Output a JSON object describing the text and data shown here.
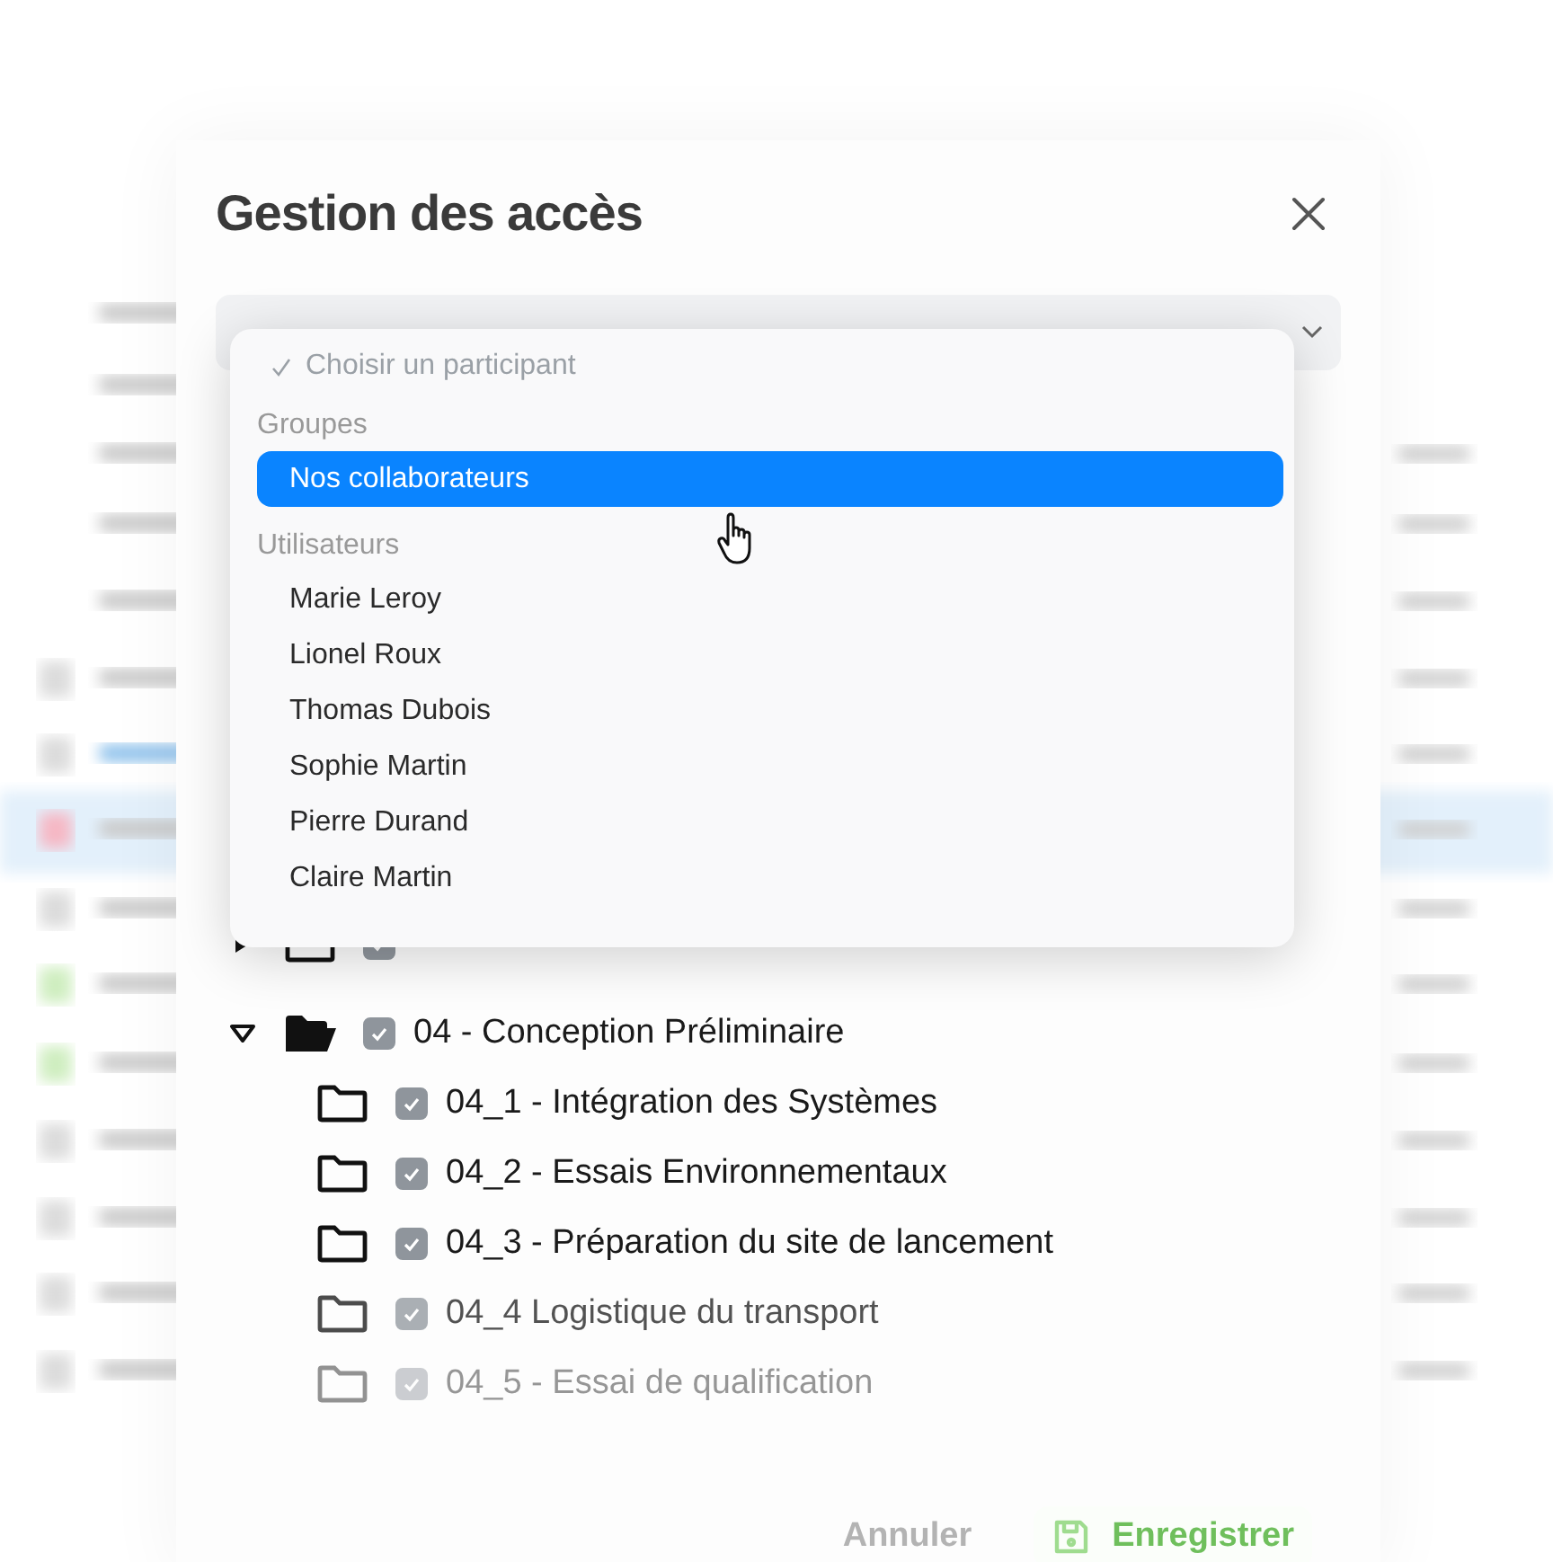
{
  "dialog": {
    "title": "Gestion des accès"
  },
  "select": {
    "expanded": true
  },
  "dropdown": {
    "header": "Choisir un participant",
    "groups": [
      {
        "label": "Groupes",
        "items": [
          {
            "label": "Nos collaborateurs",
            "selected": true
          }
        ]
      },
      {
        "label": "Utilisateurs",
        "items": [
          {
            "label": "Marie Leroy",
            "selected": false
          },
          {
            "label": "Lionel Roux",
            "selected": false
          },
          {
            "label": "Thomas Dubois",
            "selected": false
          },
          {
            "label": "Sophie Martin",
            "selected": false
          },
          {
            "label": "Pierre Durand",
            "selected": false
          },
          {
            "label": "Claire Martin",
            "selected": false
          }
        ]
      }
    ]
  },
  "tree": [
    {
      "checked": true,
      "expanded": false
    },
    {
      "label": "04 - Conception Préliminaire",
      "checked": true,
      "expanded": true,
      "children": [
        {
          "label": "04_1 - Intégration des Systèmes",
          "checked": true
        },
        {
          "label": "04_2 - Essais Environnementaux",
          "checked": true
        },
        {
          "label": "04_3 - Préparation du site de lancement",
          "checked": true
        },
        {
          "label": "04_4 Logistique du transport",
          "checked": true
        },
        {
          "label": "04_5 - Essai de qualification",
          "checked": true
        }
      ]
    }
  ],
  "buttons": [
    {
      "label": "Annuler",
      "kind": "cancel"
    },
    {
      "label": "Enregistrer",
      "kind": "save"
    }
  ]
}
